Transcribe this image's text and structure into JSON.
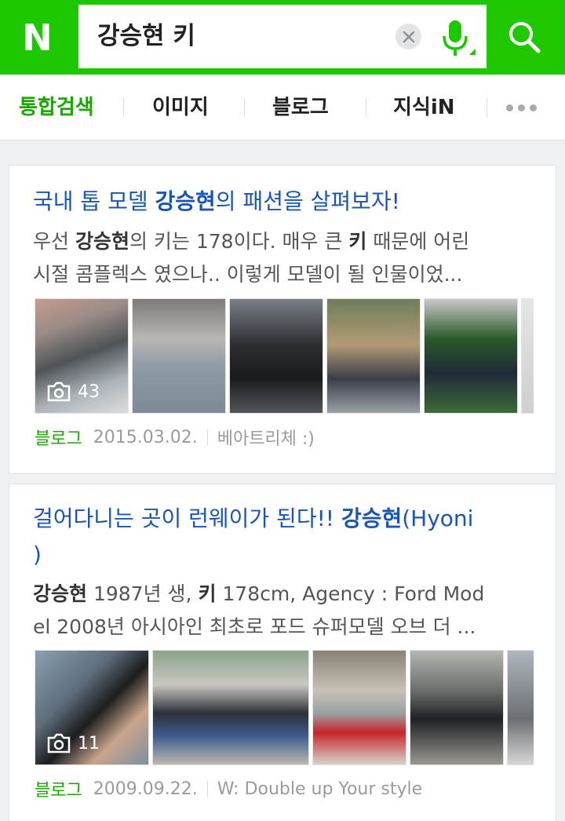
{
  "header": {
    "logo_letter": "N",
    "query": "강승현 키",
    "icons": {
      "clear": "clear-x-icon",
      "mic": "microphone-icon",
      "search": "magnifier-icon"
    },
    "colors": {
      "brand": "#1ec800",
      "mic": "#1ec800"
    }
  },
  "tabs": [
    {
      "label": "통합검색",
      "active": true
    },
    {
      "label": "이미지",
      "active": false
    },
    {
      "label": "블로그",
      "active": false
    },
    {
      "label": "지식iN",
      "active": false
    }
  ],
  "more_icon": "more-dots-icon",
  "results": [
    {
      "title_prefix": "국내 톱 모델 ",
      "title_highlight": "강승현",
      "title_suffix": "의 패션을 살펴보자!",
      "desc_line1_a": "우선 ",
      "desc_line1_hl1": "강승현",
      "desc_line1_b": "의 키는 178이다. 매우 큰 ",
      "desc_line1_hl2": "키",
      "desc_line1_c": " 때문에 어린",
      "desc_line2": "시절 콤플렉스 였으나.. 이렇게 모델이 될 인물이었...",
      "photo_count": "43",
      "source": "블로그",
      "date": "2015.03.02.",
      "author": "베아트리체 :)"
    },
    {
      "title_line1_prefix": "걸어다니는 곳이 런웨이가 된다!! ",
      "title_highlight": "강승현",
      "title_line1_suffix": "(Hyoni",
      "title_line2": ")",
      "desc_line1_hl1": "강승현",
      "desc_line1_a": " 1987년 생, ",
      "desc_line1_hl2": "키",
      "desc_line1_b": " 178cm, Agency : Ford Mod",
      "desc_line2": "el 2008년 아시아인 최초로 포드 슈퍼모델 오브 더 ...",
      "photo_count": "11",
      "source": "블로그",
      "date": "2009.09.22.",
      "author": "W: Double up Your style"
    }
  ]
}
